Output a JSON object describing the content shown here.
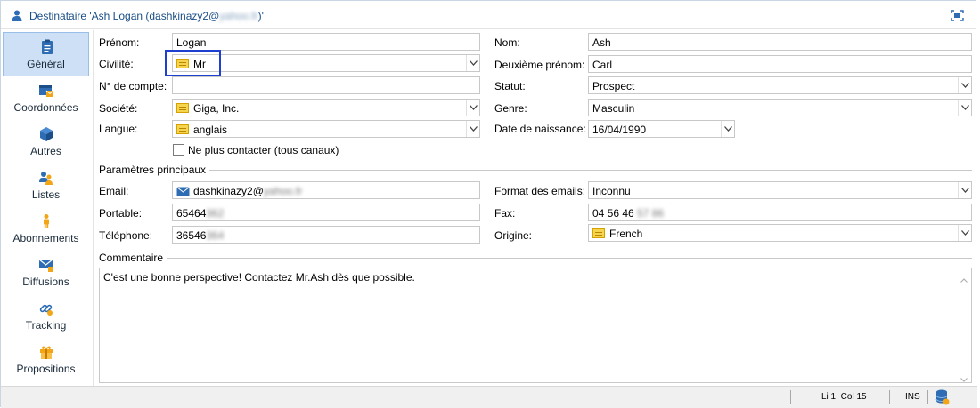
{
  "title": {
    "prefix": "Destinataire 'Ash Logan (dashkinazy2@",
    "blurred": "yahoo.fr",
    "suffix": ")'"
  },
  "sidebar": {
    "items": [
      {
        "label": "Général",
        "icon": "clipboard-icon"
      },
      {
        "label": "Coordonnées",
        "icon": "address-card-icon"
      },
      {
        "label": "Autres",
        "icon": "cube-icon"
      },
      {
        "label": "Listes",
        "icon": "users-icon"
      },
      {
        "label": "Abonnements",
        "icon": "person-icon"
      },
      {
        "label": "Diffusions",
        "icon": "envelope-icon"
      },
      {
        "label": "Tracking",
        "icon": "link-icon"
      },
      {
        "label": "Propositions",
        "icon": "gift-icon"
      }
    ]
  },
  "form": {
    "prenom_label": "Prénom:",
    "prenom_value": "Logan",
    "civilite_label": "Civilité:",
    "civilite_value": "Mr",
    "compte_label": "N° de compte:",
    "compte_value": "",
    "societe_label": "Société:",
    "societe_value": "Giga, Inc.",
    "langue_label": "Langue:",
    "langue_value": "anglais",
    "no_contact_label": "Ne plus contacter (tous canaux)",
    "nom_label": "Nom:",
    "nom_value": "Ash",
    "deuxieme_label": "Deuxième prénom:",
    "deuxieme_value": "Carl",
    "statut_label": "Statut:",
    "statut_value": "Prospect",
    "genre_label": "Genre:",
    "genre_value": "Masculin",
    "naissance_label": "Date de naissance:",
    "naissance_value": "16/04/1990"
  },
  "params": {
    "section_title": "Paramètres principaux",
    "email_label": "Email:",
    "email_value": "dashkinazy2@",
    "email_blurred": "yahoo.fr",
    "portable_label": "Portable:",
    "portable_value": "65464",
    "portable_blurred": "362",
    "telephone_label": "Téléphone:",
    "telephone_value": "36546",
    "telephone_blurred": "364",
    "format_label": "Format des emails:",
    "format_value": "Inconnu",
    "fax_label": "Fax:",
    "fax_value": "04 56 46",
    "fax_blurred": "57 86",
    "origine_label": "Origine:",
    "origine_value": "French"
  },
  "comment": {
    "section_title": "Commentaire",
    "text": "C'est une bonne perspective! Contactez Mr.Ash dès que possible."
  },
  "status": {
    "position": "Li 1, Col 15",
    "mode": "INS"
  }
}
